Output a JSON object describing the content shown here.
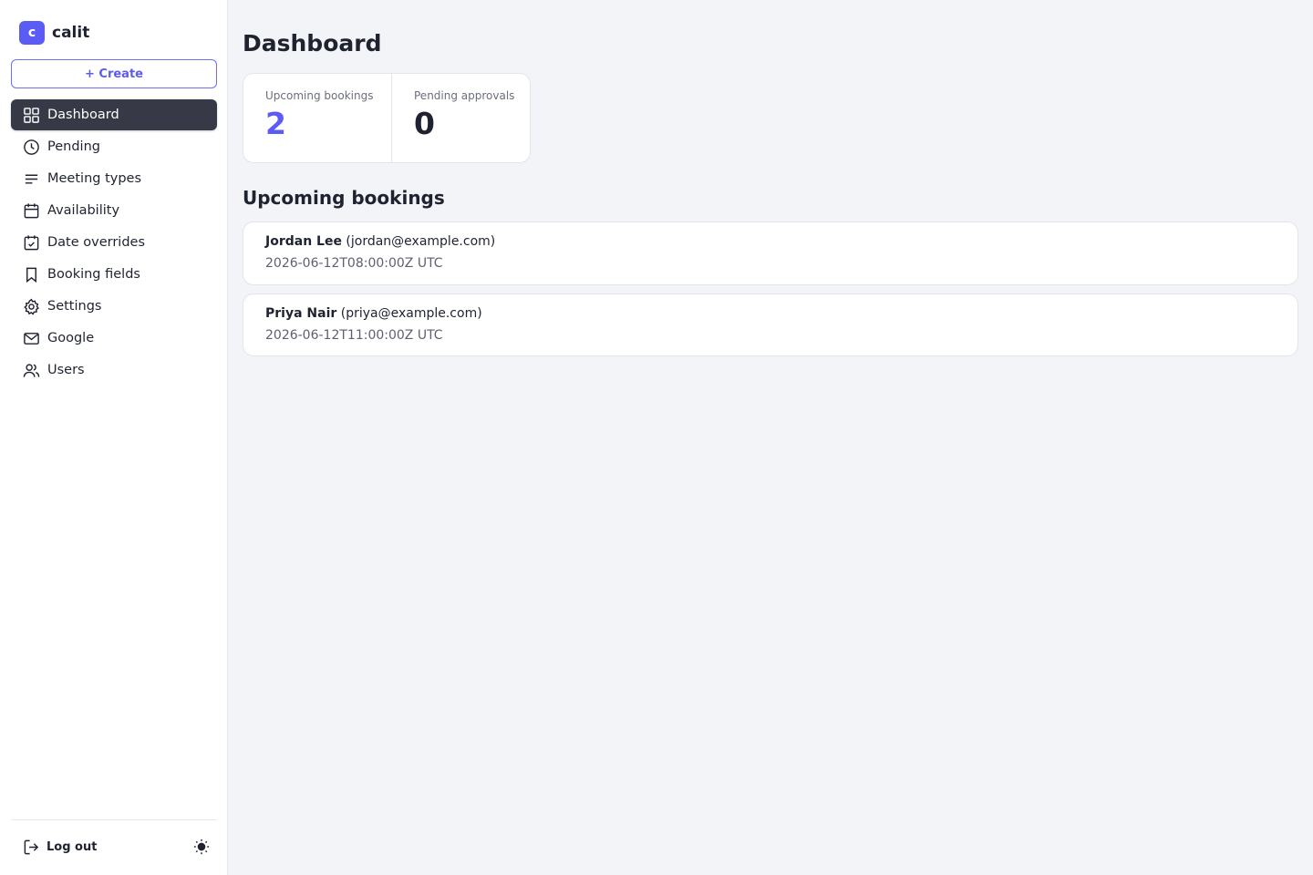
{
  "app": {
    "logo_letter": "c",
    "name": "calit"
  },
  "sidebar": {
    "create_label": "+ Create",
    "items": [
      {
        "label": "Dashboard",
        "icon": "grid-icon",
        "active": true
      },
      {
        "label": "Pending",
        "icon": "clock-icon"
      },
      {
        "label": "Meeting types",
        "icon": "list-icon"
      },
      {
        "label": "Availability",
        "icon": "calendar-icon"
      },
      {
        "label": "Date overrides",
        "icon": "calendar-check-icon"
      },
      {
        "label": "Booking fields",
        "icon": "bookmark-icon"
      },
      {
        "label": "Settings",
        "icon": "gear-icon"
      },
      {
        "label": "Google",
        "icon": "mail-icon"
      },
      {
        "label": "Users",
        "icon": "users-icon"
      }
    ],
    "logout_label": "Log out",
    "theme_icon": "sun-icon"
  },
  "main": {
    "title": "Dashboard",
    "stats": [
      {
        "label": "Upcoming bookings",
        "value": "2",
        "accent": true
      },
      {
        "label": "Pending approvals",
        "value": "0",
        "accent": false
      }
    ],
    "section_title": "Upcoming bookings",
    "bookings": [
      {
        "name": "Jordan Lee",
        "email": "(jordan@example.com)",
        "time": "2026-06-12T08:00:00Z UTC"
      },
      {
        "name": "Priya Nair",
        "email": "(priya@example.com)",
        "time": "2026-06-12T11:00:00Z UTC"
      }
    ]
  },
  "colors": {
    "accent": "#5b5bf5",
    "active_nav": "#373a46",
    "background": "#f3f4f8"
  }
}
